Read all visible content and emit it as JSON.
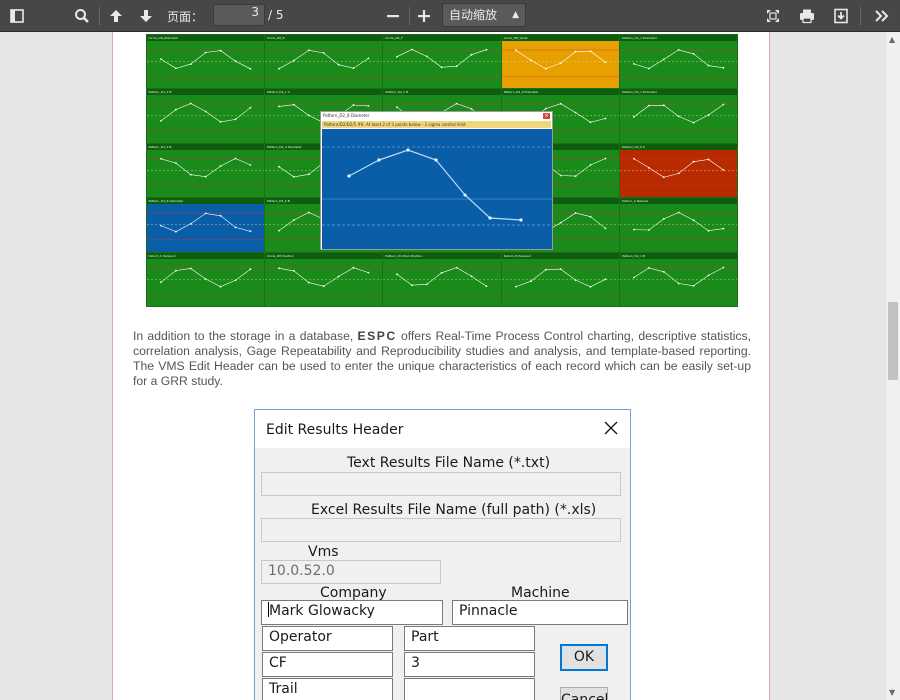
{
  "toolbar": {
    "page_label": "页面：",
    "page_current": "3",
    "page_total": "/ 5",
    "zoom_value": "自动缩放"
  },
  "chart_grid": {
    "tiles": [
      {
        "title": "Circle_D8_Diameter",
        "color": "#1a8a1a"
      },
      {
        "title": "Circle_D8_B",
        "color": "#1a8a1a"
      },
      {
        "title": "Circle_D8_F",
        "color": "#1a8a1a"
      },
      {
        "title": "Circle_D8_Vents",
        "color": "#e6a000"
      },
      {
        "title": "Pattern_D2_1 Diameter",
        "color": "#1a8a1a"
      },
      {
        "title": "Pattern_D4_1 B",
        "color": "#1a8a1a"
      },
      {
        "title": "Pattern_D4_1 V",
        "color": "#1a8a1a"
      },
      {
        "title": "Pattern_D4_1 B",
        "color": "#1a8a1a"
      },
      {
        "title": "Pattern_D4_8 Diameter",
        "color": "#1a8a1a"
      },
      {
        "title": "Pattern_D4_1 Diameter",
        "color": "#1a8a1a"
      },
      {
        "title": "Pattern_D4_1 B",
        "color": "#1a8a1a"
      },
      {
        "title": "Pattern_D4_4 Diameter",
        "color": "#1a8a1a"
      },
      {
        "title": "Pattern_D4_3 Diameter",
        "color": "#1a8a1a"
      },
      {
        "title": "Pattern_D4_S",
        "color": "#1a8a1a"
      },
      {
        "title": "Pattern_D4_5 S",
        "color": "#b82a00"
      },
      {
        "title": "Pattern_D4_6 Diameter",
        "color": "#0a5ea8"
      },
      {
        "title": "Pattern_D4_S B",
        "color": "#1a8a1a"
      },
      {
        "title": "Pattern_D4_8",
        "color": "#1a8a1a"
      },
      {
        "title": "Pattern_D4_8",
        "color": "#1a8a1a"
      },
      {
        "title": "Datum_A Nabove",
        "color": "#1a8a1a"
      },
      {
        "title": "Datum_C Perpend",
        "color": "#1a8a1a"
      },
      {
        "title": "Circle_D8 Position",
        "color": "#1a8a1a"
      },
      {
        "title": "Pattern_D4 Pos4 Position",
        "color": "#1a8a1a"
      },
      {
        "title": "Datum_B Perpend",
        "color": "#1a8a1a"
      },
      {
        "title": "Pattern_D2_1 B",
        "color": "#1a8a1a"
      }
    ],
    "popup": {
      "title": "Pattern_D2_8 Diameter",
      "alarm": "Pattern/D2/D2/5 #6: At least 2 of 3 points below - 2 sigma control limit"
    }
  },
  "paragraph": {
    "text_before": "In addition to the storage in a database, ",
    "brand": "ESPC",
    "text_after": " offers Real-Time Process Control charting, descriptive statistics, correlation analysis, Gage Repeatability and Reproducibility studies and analysis, and template-based reporting. The VMS Edit Header can be used to enter the unique characteristics of each record which can be easily set-up for a GRR study."
  },
  "dialog": {
    "title": "Edit Results Header",
    "text_results_label": "Text Results File Name (*.txt)",
    "text_results_value": "",
    "excel_results_label": "Excel Results File Name (full path) (*.xls)",
    "excel_results_value": "",
    "vms_label": "Vms",
    "vms_value": "10.0.52.0",
    "company_label": "Company",
    "company_value": "Mark Glowacky",
    "machine_label": "Machine",
    "machine_value": "Pinnacle",
    "operator_value": "Operator",
    "part_value": "Part",
    "cf_value": "CF",
    "cf_number_value": "3",
    "trail_value": "Trail",
    "trail_number_value": "",
    "ok_label": "OK",
    "cancel_label": "Cancel"
  }
}
